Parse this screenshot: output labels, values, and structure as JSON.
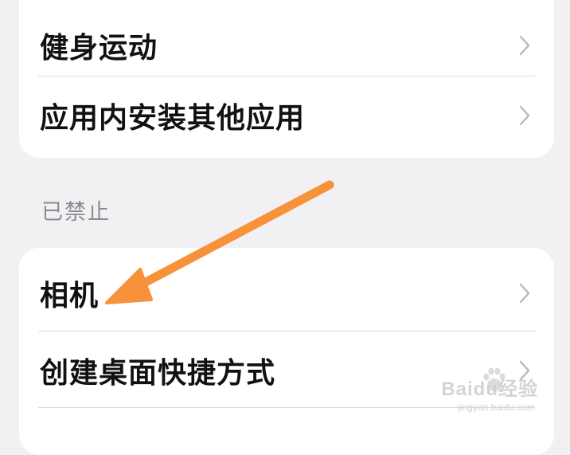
{
  "sections": {
    "allowed": {
      "items": [
        {
          "label": "健身运动"
        },
        {
          "label": "应用内安装其他应用"
        }
      ]
    },
    "forbidden": {
      "header": "已禁止",
      "items": [
        {
          "label": "相机"
        },
        {
          "label": "创建桌面快捷方式"
        }
      ]
    }
  },
  "annotation": {
    "arrow_color": "#f7923a"
  },
  "watermark": {
    "logo_text": "Baidu经验",
    "url_text": "jingyan.baidu.com"
  },
  "colors": {
    "background": "#f1f1f3",
    "card": "#ffffff",
    "chevron": "#b9b9bd",
    "section_header": "#8a8a8f"
  }
}
